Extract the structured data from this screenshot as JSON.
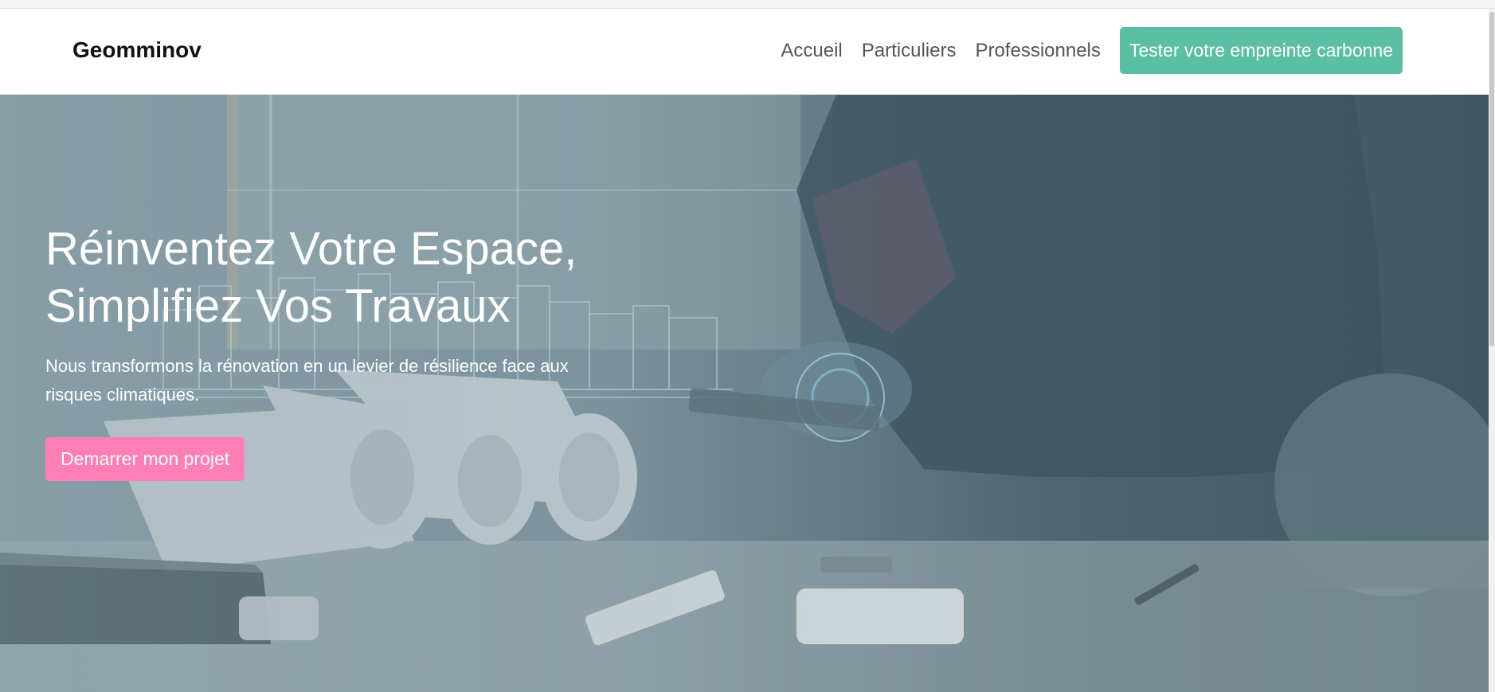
{
  "navbar": {
    "brand": "Geomminov",
    "links": [
      "Accueil",
      "Particuliers",
      "Professionnels"
    ],
    "cta_label": "Tester votre empreinte carbonne"
  },
  "hero": {
    "title_line1": "Réinventez Votre Espace,",
    "title_line2": "Simplifiez Vos Travaux",
    "subtitle_line1": "Nous transformons la rénovation en un levier de résilience face aux",
    "subtitle_line2": "risques climatiques.",
    "button_label": "Demarrer mon projet"
  },
  "colors": {
    "cta": "#5bbfa3",
    "hero_button": "#ff7eb3"
  }
}
